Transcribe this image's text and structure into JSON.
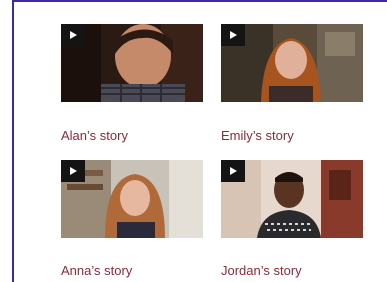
{
  "stories": [
    {
      "caption": "Alan’s story"
    },
    {
      "caption": "Emily’s story"
    },
    {
      "caption": "Anna’s story"
    },
    {
      "caption": "Jordan’s story"
    }
  ],
  "icons": {
    "play": "play-icon"
  },
  "colors": {
    "border": "#3b2aa8",
    "caption": "#8a2a3c"
  }
}
